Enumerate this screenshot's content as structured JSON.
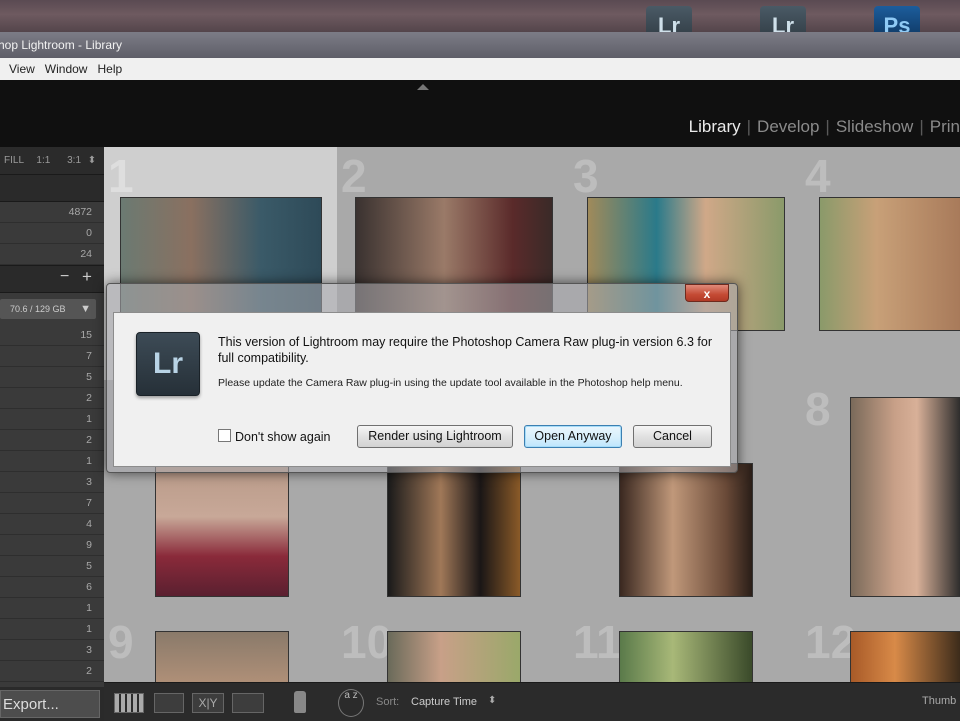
{
  "desktop": {
    "icons": [
      "Lr",
      "Lr",
      "Ps"
    ]
  },
  "window": {
    "title": "hop Lightroom - Library"
  },
  "menu": [
    "View",
    "Window",
    "Help"
  ],
  "modules": {
    "library": "Library",
    "develop": "Develop",
    "slideshow": "Slideshow",
    "print": "Prin",
    "separator": "|"
  },
  "navigator": {
    "fill": "FILL",
    "one_one": "1:1",
    "three_one": "3:1"
  },
  "catalog_counts": [
    "4872",
    "0",
    "24"
  ],
  "folders": {
    "add": "+",
    "remove": "−",
    "disk": "70.6 / 129 GB"
  },
  "folder_counts": [
    "15",
    "7",
    "5",
    "2",
    "1",
    "2",
    "1",
    "3",
    "7",
    "4",
    "9",
    "5",
    "6",
    "1",
    "1",
    "3",
    "2"
  ],
  "grid": {
    "cell_numbers": [
      "1",
      "2",
      "3",
      "4",
      "8",
      "9",
      "10",
      "11",
      "12"
    ]
  },
  "toolbar": {
    "sort_label": "Sort:",
    "sort_value": "Capture Time",
    "thumbnails_label": "Thumb",
    "export_button": "Export...",
    "az_label": "a z"
  },
  "dialog": {
    "message": "This version of Lightroom may require the Photoshop Camera Raw plug-in version 6.3 for full compatibility.",
    "submessage": "Please update the Camera Raw plug-in using the update tool available in the Photoshop help menu.",
    "checkbox_label": "Don't show again",
    "render_button": "Render using Lightroom",
    "open_button": "Open Anyway",
    "cancel_button": "Cancel",
    "close_glyph": "x",
    "logo_text": "Lr"
  },
  "colors": {
    "lr_background": "#101010",
    "grid": "#a9a9a9",
    "dialog_bg": "#f0f0f0",
    "default_button": "#3c7fb1",
    "close_button": "#c44a34"
  }
}
